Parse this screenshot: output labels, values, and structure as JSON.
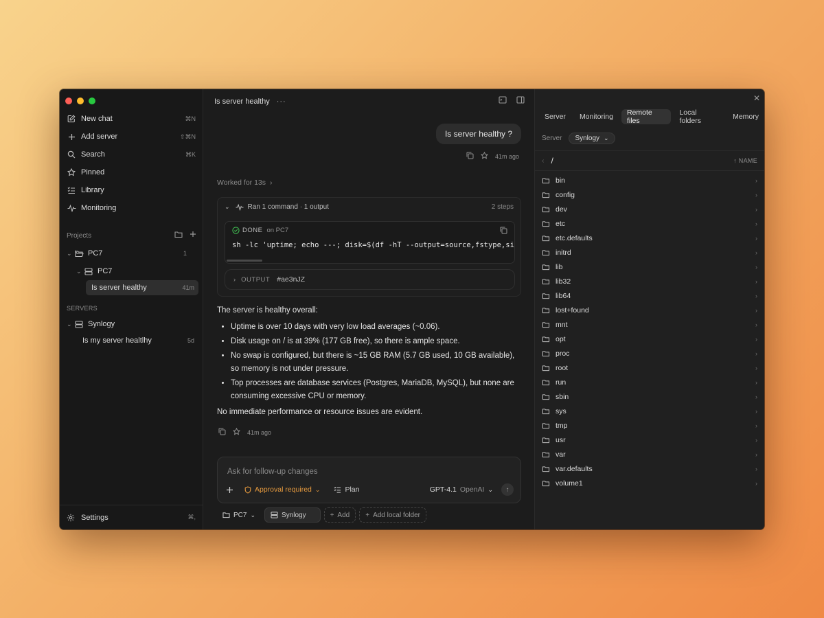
{
  "sidebar": {
    "nav": [
      {
        "label": "New chat",
        "shortcut": "⌘N",
        "icon": "edit-icon"
      },
      {
        "label": "Add server",
        "shortcut": "⇧⌘N",
        "icon": "plus-icon"
      },
      {
        "label": "Search",
        "shortcut": "⌘K",
        "icon": "search-icon"
      },
      {
        "label": "Pinned",
        "shortcut": "",
        "icon": "star-icon"
      },
      {
        "label": "Library",
        "shortcut": "",
        "icon": "list-icon"
      },
      {
        "label": "Monitoring",
        "shortcut": "",
        "icon": "pulse-icon"
      }
    ],
    "projects_label": "Projects",
    "project": {
      "name": "PC7",
      "count": "1"
    },
    "project_server": {
      "name": "PC7"
    },
    "project_chat": {
      "title": "Is server healthy",
      "age": "41m"
    },
    "servers_label": "SERVERS",
    "server": {
      "name": "Synlogy"
    },
    "server_chat": {
      "title": "Is my server healtlhy",
      "age": "5d"
    },
    "settings": {
      "label": "Settings",
      "shortcut": "⌘,"
    }
  },
  "main": {
    "title": "Is server healthy",
    "user_message": "Is server healthy ?",
    "user_message_age": "41m ago",
    "worked_for": "Worked for 13s",
    "tool": {
      "summary": "Ran 1 command · 1 output",
      "steps": "2 steps",
      "status": "DONE",
      "host": "on PC7",
      "command": "sh -lc 'uptime; echo ---; disk=$(df -hT --output=source,fstype,size,",
      "output_label": "OUTPUT",
      "output_id": "#ae3nJZ"
    },
    "answer": {
      "intro": "The server is healthy overall:",
      "bullets": [
        "Uptime is over 10 days with very low load averages (~0.06).",
        "Disk usage on / is at 39% (177 GB free), so there is ample space.",
        "No swap is configured, but there is ~15 GB RAM (5.7 GB used, 10 GB available), so memory is not under pressure.",
        "Top processes are database services (Postgres, MariaDB, MySQL), but none are consuming excessive CPU or memory."
      ],
      "conclusion": "No immediate performance or resource issues are evident.",
      "age": "41m ago"
    },
    "composer": {
      "placeholder": "Ask for follow-up changes",
      "approval": "Approval required",
      "plan": "Plan",
      "model": "GPT-4.1",
      "provider": "OpenAI"
    },
    "chips": {
      "project": "PC7",
      "server": "Synlogy",
      "add": "Add",
      "add_folder": "Add local folder"
    }
  },
  "right": {
    "tabs": [
      "Server",
      "Monitoring",
      "Remote files",
      "Local folders",
      "Memory"
    ],
    "active_tab": "Remote files",
    "server_label": "Server",
    "server_value": "Synlogy",
    "path": "/",
    "sort_label": "NAME",
    "files": [
      "bin",
      "config",
      "dev",
      "etc",
      "etc.defaults",
      "initrd",
      "lib",
      "lib32",
      "lib64",
      "lost+found",
      "mnt",
      "opt",
      "proc",
      "root",
      "run",
      "sbin",
      "sys",
      "tmp",
      "usr",
      "var",
      "var.defaults",
      "volume1"
    ]
  }
}
